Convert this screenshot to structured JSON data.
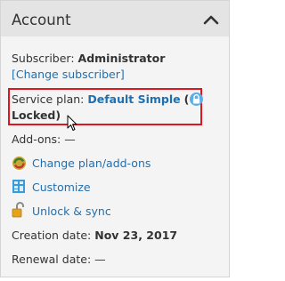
{
  "panel": {
    "title": "Account",
    "subscriber_label": "Subscriber:",
    "subscriber_value": "Administrator",
    "change_subscriber_link": "[Change subscriber]",
    "service_plan_label": "Service plan:",
    "service_plan_value": "Default Simple",
    "locked_open": "(",
    "locked_text": "Locked)",
    "addons_label": "Add-ons:",
    "addons_value": "—",
    "actions": [
      {
        "label": "Change plan/add-ons",
        "icon": "change-plan-icon"
      },
      {
        "label": "Customize",
        "icon": "customize-icon"
      },
      {
        "label": "Unlock & sync",
        "icon": "unlock-icon"
      }
    ],
    "creation_label": "Creation date:",
    "creation_value": "Nov 23, 2017",
    "renewal_label": "Renewal date:",
    "renewal_value": "—"
  },
  "colors": {
    "link": "#1f6fb1",
    "highlight": "#e0161f",
    "header_bg": "#e4e4e4",
    "panel_bg": "#f4f4f4"
  }
}
